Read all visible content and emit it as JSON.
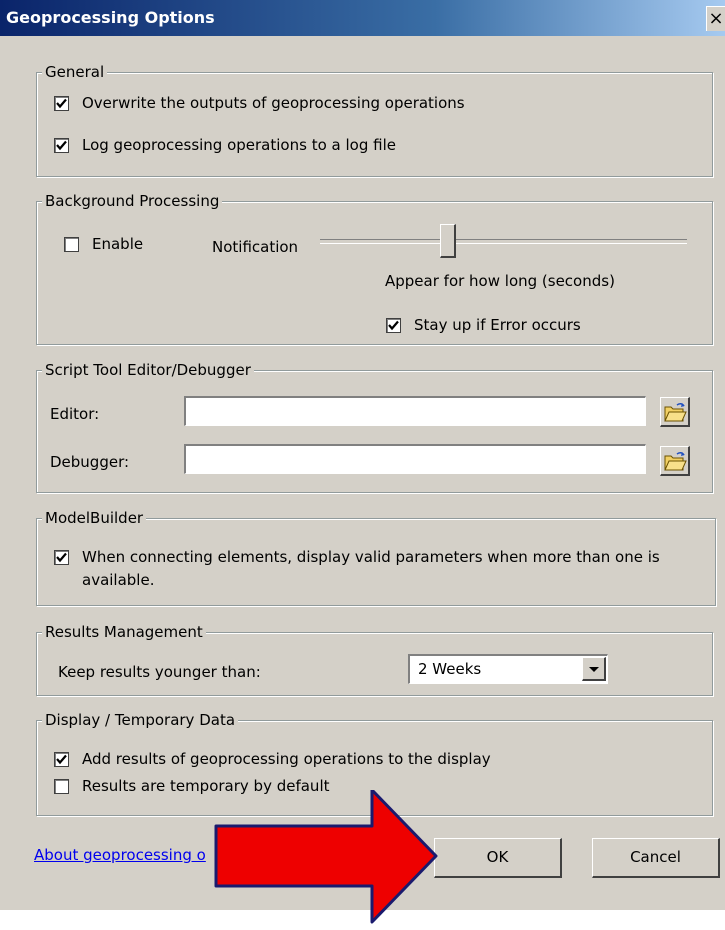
{
  "window": {
    "title": "Geoprocessing Options",
    "close_glyph": "×"
  },
  "general": {
    "title": "General",
    "overwrite": {
      "label": "Overwrite the outputs of geoprocessing operations",
      "checked": true
    },
    "log": {
      "label": "Log geoprocessing operations to a log file",
      "checked": true
    }
  },
  "background": {
    "title": "Background Processing",
    "enable": {
      "label": "Enable",
      "checked": false
    },
    "notification_label": "Notification",
    "notification_level": 0.35,
    "appear_label": "Appear for how long (seconds)",
    "stay_up": {
      "label": "Stay up if Error occurs",
      "checked": true
    }
  },
  "script_editor": {
    "title": "Script Tool Editor/Debugger",
    "editor_label": "Editor:",
    "editor_value": "",
    "debugger_label": "Debugger:",
    "debugger_value": ""
  },
  "modelbuilder": {
    "title": "ModelBuilder",
    "valid_params": {
      "label_line1": "When connecting elements, display valid parameters when more than one is",
      "label_line2": "available.",
      "checked": true
    }
  },
  "results": {
    "title": "Results Management",
    "keep_label": "Keep results younger than:",
    "keep_value": "2 Weeks"
  },
  "display": {
    "title": "Display / Temporary Data",
    "add_results": {
      "label": "Add results of geoprocessing operations to the display",
      "checked": true
    },
    "temporary": {
      "label": "Results are temporary by default",
      "checked": false
    }
  },
  "footer": {
    "about_link": "About geoprocessing o",
    "ok_label": "OK",
    "cancel_label": "Cancel"
  },
  "annotation": {
    "arrow_color": "#ee0000",
    "arrow_outline": "#1a1a6e"
  },
  "icons": {
    "browse": "folder-open-icon",
    "dropdown": "dropdown-arrow-icon",
    "check": "check-icon"
  }
}
